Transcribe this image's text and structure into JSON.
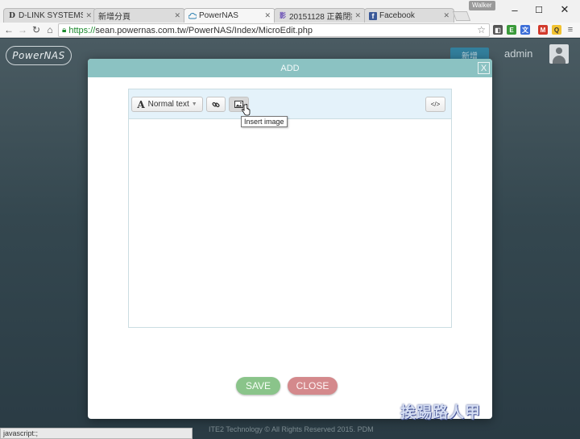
{
  "browser": {
    "tabs": [
      {
        "title": "D-LINK SYSTEMS, I",
        "icon": "D"
      },
      {
        "title": "新增分頁",
        "icon": ""
      },
      {
        "title": "PowerNAS",
        "icon": "cloud"
      },
      {
        "title": "20151128 正義閉鈔",
        "icon": "影"
      },
      {
        "title": "Facebook",
        "icon": "f"
      }
    ],
    "profile_name": "Walker",
    "url_scheme": "https://",
    "url_rest": "sean.powernas.com.tw/PowerNAS/Index/MicroEdit.php",
    "window_buttons": [
      "–",
      "☐",
      "✕"
    ],
    "status_text": "javascript:;"
  },
  "app": {
    "logo_text": "PowerNAS",
    "add_new_label": "新增",
    "username": "admin",
    "footer": "ITE2 Technology © All Rights Reserved 2015. PDM"
  },
  "modal": {
    "title": "ADD",
    "close_label": "X",
    "editor": {
      "heading_style_icon": "A",
      "heading_style_label": "Normal text",
      "link_icon": "link-icon",
      "image_icon": "image-icon",
      "source_label": "</>",
      "tooltip": "Insert image",
      "content": ""
    },
    "save_label": "SAVE",
    "close_button_label": "CLOSE"
  },
  "watermark": "挨踢路人甲",
  "colors": {
    "modal_header": "#8bc2c2",
    "save_button": "#8ac48a",
    "close_button": "#d4898c",
    "editor_toolbar": "#e4f2fa",
    "add_new_button": "#2f86a7"
  }
}
